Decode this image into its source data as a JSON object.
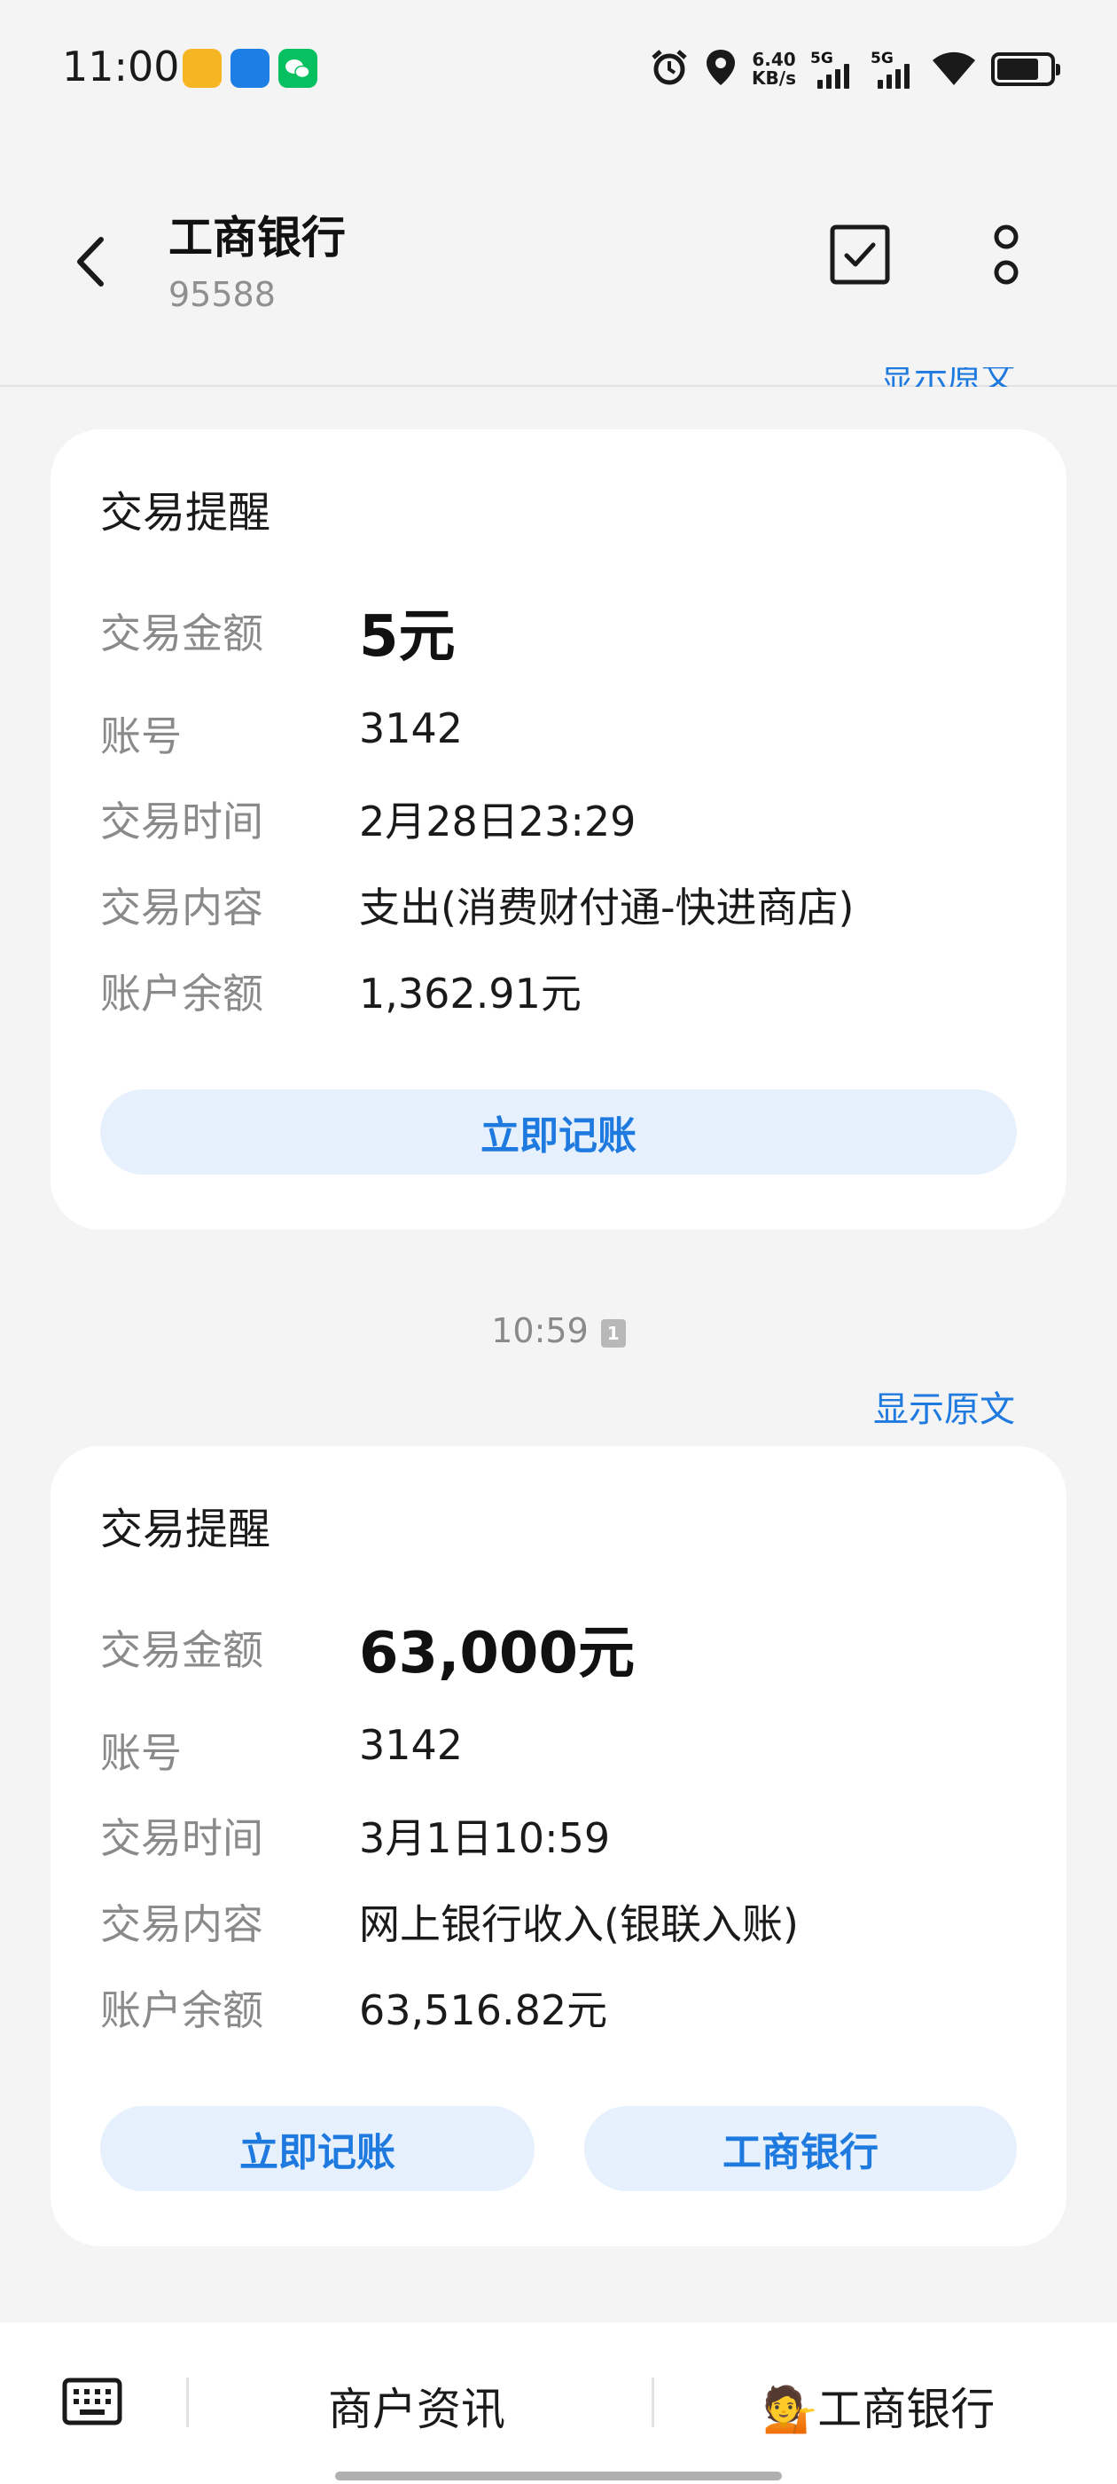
{
  "status_bar": {
    "time": "11:00",
    "net_speed_value": "6.40",
    "net_speed_unit": "KB/s",
    "signal_1_label": "5G",
    "signal_2_label": "5G"
  },
  "header": {
    "title": "工商银行",
    "subtitle": "95588"
  },
  "previous_show_original": "显示原文",
  "card1": {
    "title": "交易提醒",
    "rows": [
      {
        "label": "交易金额",
        "value": "5元"
      },
      {
        "label": "账号",
        "value": "3142"
      },
      {
        "label": "交易时间",
        "value": "2月28日23:29"
      },
      {
        "label": "交易内容",
        "value": "支出(消费财付通-快进商店)"
      },
      {
        "label": "账户余额",
        "value": "1,362.91元"
      }
    ],
    "button": "立即记账"
  },
  "message2": {
    "time": "10:59",
    "badge": "1",
    "show_original": "显示原文"
  },
  "card2": {
    "title": "交易提醒",
    "rows": [
      {
        "label": "交易金额",
        "value": "63,000元"
      },
      {
        "label": "账号",
        "value": "3142"
      },
      {
        "label": "交易时间",
        "value": "3月1日10:59"
      },
      {
        "label": "交易内容",
        "value": "网上银行收入(银联入账)"
      },
      {
        "label": "账户余额",
        "value": "63,516.82元"
      }
    ],
    "button_left": "立即记账",
    "button_right": "工商银行"
  },
  "bottom_bar": {
    "menu_1": "商户资讯",
    "menu_2": "工商银行",
    "menu_2_emoji": "💁"
  },
  "colors": {
    "accent": "#1f7ae0",
    "pill_bg": "#e6f1fd",
    "page_bg": "#f4f4f4"
  }
}
